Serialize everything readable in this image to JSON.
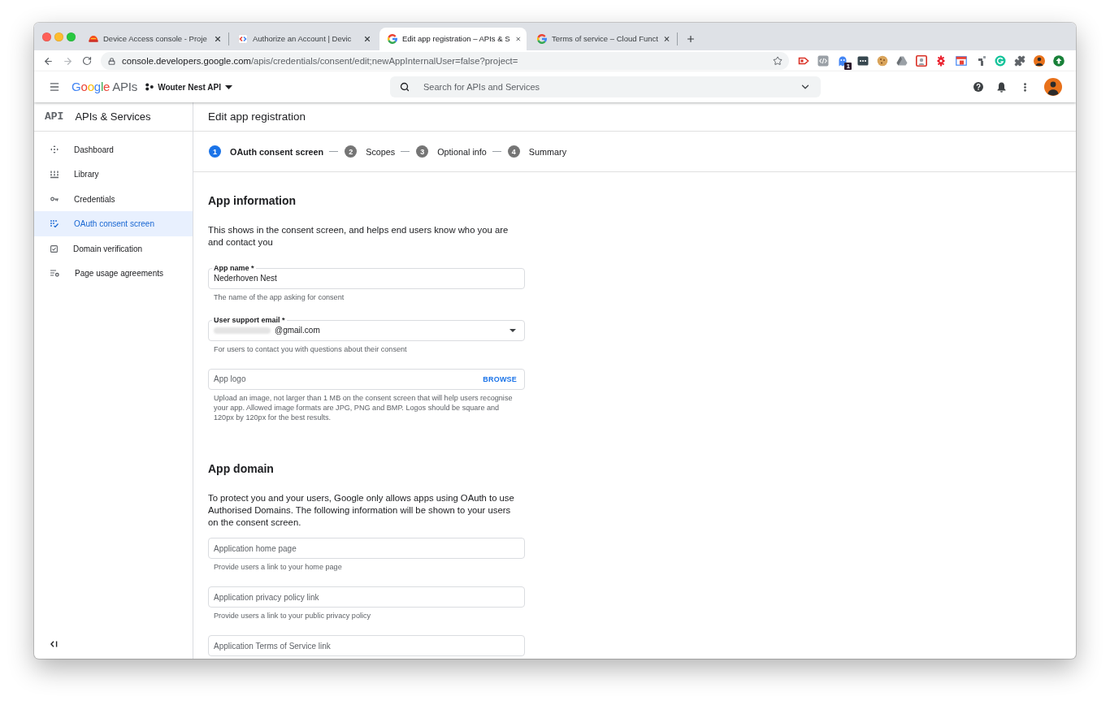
{
  "browser": {
    "tabs": [
      {
        "kind": "nest",
        "title": "Device Access console - Proje",
        "selected": false
      },
      {
        "kind": "code",
        "title": "Authorize an Account | Devic",
        "selected": false
      },
      {
        "kind": "google",
        "title": "Edit app registration – APIs & S",
        "selected": true
      },
      {
        "kind": "google",
        "title": "Terms of service – Cloud Funct",
        "selected": false
      }
    ],
    "address": {
      "host": "console.developers.google.com",
      "path": "/apis/credentials/consent/edit;newAppInternalUser=false?project="
    },
    "extension_badge": "1"
  },
  "header": {
    "logo": {
      "brand": "Google",
      "product": "APIs"
    },
    "project": "Wouter Nest API",
    "search": {
      "placeholder": "Search for APIs and Services"
    }
  },
  "sidebar": {
    "logo": "API",
    "title": "APIs & Services",
    "items": [
      {
        "kind": "dashboard",
        "label": "Dashboard",
        "selected": false
      },
      {
        "kind": "library",
        "label": "Library",
        "selected": false
      },
      {
        "kind": "credentials",
        "label": "Credentials",
        "selected": false
      },
      {
        "kind": "oauth",
        "label": "OAuth consent screen",
        "selected": true
      },
      {
        "kind": "domain",
        "label": "Domain verification",
        "selected": false
      },
      {
        "kind": "agreements",
        "label": "Page usage agreements",
        "selected": false
      }
    ]
  },
  "page": {
    "title": "Edit app registration",
    "steps": [
      {
        "number": "1",
        "label": "OAuth consent screen",
        "selected": true
      },
      {
        "number": "2",
        "label": "Scopes",
        "selected": false
      },
      {
        "number": "3",
        "label": "Optional info",
        "selected": false
      },
      {
        "number": "4",
        "label": "Summary",
        "selected": false
      }
    ],
    "sections": [
      {
        "heading": "App information",
        "description": "This shows in the consent screen, and helps end users know who you are and contact you",
        "fields": [
          {
            "kind": "text",
            "label": "App name *",
            "value": "Nederhoven Nest",
            "helper": "The name of the app asking for consent"
          },
          {
            "kind": "select",
            "label": "User support email *",
            "value": "@gmail.com",
            "redacted_prefix": true,
            "helper": "For users to contact you with questions about their consent"
          },
          {
            "kind": "file",
            "placeholder": "App logo",
            "action": "BROWSE",
            "helper": "Upload an image, not larger than 1 MB on the consent screen that will help users recognise your app. Allowed image formats are JPG, PNG and BMP. Logos should be square and 120px by 120px for the best results."
          }
        ]
      },
      {
        "heading": "App domain",
        "description": "To protect you and your users, Google only allows apps using OAuth to use Authorised Domains. The following information will be shown to your users on the consent screen.",
        "fields": [
          {
            "kind": "text",
            "placeholder": "Application home page",
            "helper": "Provide users a link to your home page"
          },
          {
            "kind": "text",
            "placeholder": "Application privacy policy link",
            "helper": "Provide users a link to your public privacy policy"
          },
          {
            "kind": "text",
            "placeholder": "Application Terms of Service link"
          }
        ]
      }
    ]
  }
}
